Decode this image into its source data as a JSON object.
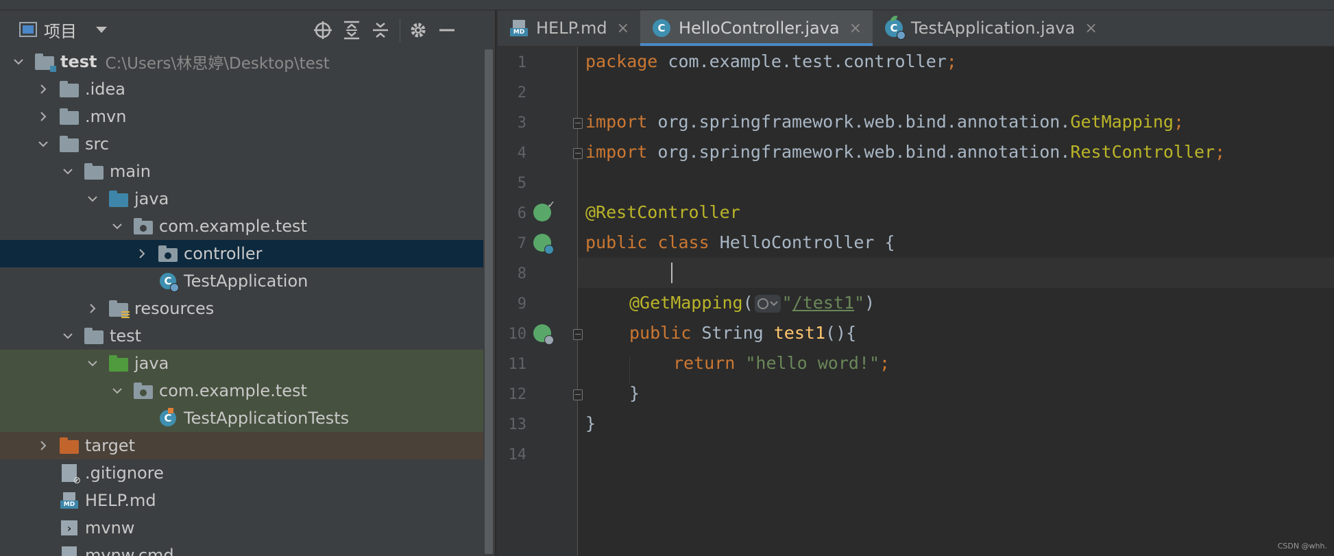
{
  "project_panel": {
    "title": "项目",
    "tools": [
      "locate-icon",
      "expand-all-icon",
      "collapse-all-icon",
      "gear-icon",
      "hide-icon"
    ],
    "root": {
      "name": "test",
      "path": "C:\\Users\\林思婷\\Desktop\\test"
    },
    "items": [
      {
        "label": ".idea"
      },
      {
        "label": ".mvn"
      },
      {
        "label": "src"
      },
      {
        "label": "main"
      },
      {
        "label": "java"
      },
      {
        "label": "com.example.test"
      },
      {
        "label": "controller"
      },
      {
        "label": "TestApplication"
      },
      {
        "label": "resources"
      },
      {
        "label": "test"
      },
      {
        "label": "java"
      },
      {
        "label": "com.example.test"
      },
      {
        "label": "TestApplicationTests"
      },
      {
        "label": "target"
      },
      {
        "label": ".gitignore"
      },
      {
        "label": "HELP.md"
      },
      {
        "label": "mvnw"
      },
      {
        "label": "mvnw.cmd"
      }
    ],
    "selected": "controller"
  },
  "editor": {
    "tabs": [
      {
        "label": "HELP.md",
        "icon": "markdown-icon",
        "close": "×"
      },
      {
        "label": "HelloController.java",
        "icon": "class-icon",
        "close": "×",
        "active": true
      },
      {
        "label": "TestApplication.java",
        "icon": "spring-class-icon",
        "close": "×"
      }
    ],
    "line_numbers": [
      "1",
      "2",
      "3",
      "4",
      "5",
      "6",
      "7",
      "8",
      "9",
      "10",
      "11",
      "12",
      "13",
      "14"
    ],
    "code": {
      "l1_kw": "package",
      "l1_rest": " com.example.test.controller",
      "l1_semi": ";",
      "l3_kw": "import",
      "l3_pkg": " org.springframework.web.bind.annotation.",
      "l3_ann": "GetMapping",
      "l3_semi": ";",
      "l4_kw": "import",
      "l4_pkg": " org.springframework.web.bind.annotation.",
      "l4_ann": "RestController",
      "l4_semi": ";",
      "l6_ann": "@RestController",
      "l7_kw1": "public",
      "l7_kw2": "class",
      "l7_name": "HelloController {",
      "l9_ann": "@GetMapping",
      "l9_open": "(",
      "l9_q1": "\"",
      "l9_url": "/test1",
      "l9_q2": "\"",
      "l9_close": ")",
      "l10_kw": "public",
      "l10_type": " String ",
      "l10_fn": "test1",
      "l10_rest": "(){",
      "l11_kw": "return",
      "l11_str": "\"hello word!\"",
      "l11_semi": ";",
      "l12": "}",
      "l13": "}"
    }
  },
  "watermark": "CSDN @whh."
}
